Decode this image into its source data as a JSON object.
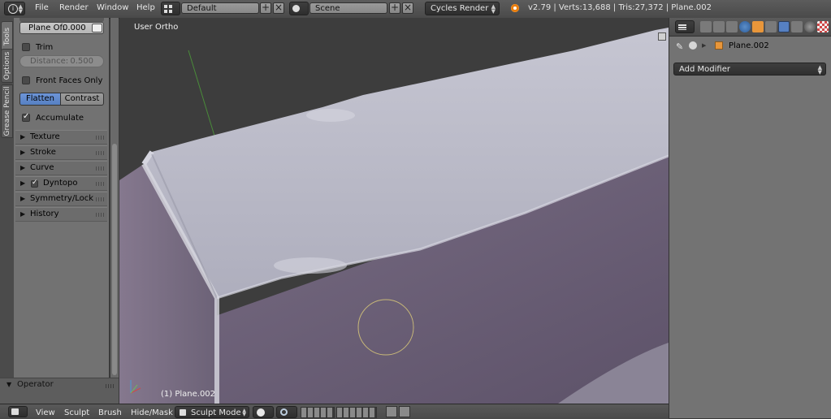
{
  "topbar": {
    "menus": [
      "File",
      "Render",
      "Window",
      "Help"
    ],
    "screen_layout": "Default",
    "scene": "Scene",
    "render_engine": "Cycles Render",
    "stats": "v2.79 | Verts:13,688 | Tris:27,372 | Plane.002"
  },
  "tabs": [
    "Tools",
    "Options",
    "Grease Pencil"
  ],
  "tool_panel": {
    "plane_offset_label": "Plane Of:",
    "plane_offset_value": "0.000",
    "trim_label": "Trim",
    "distance_label": "Distance:",
    "distance_value": "0.500",
    "front_faces_label": "Front Faces Only",
    "mode_flatten": "Flatten",
    "mode_contrast": "Contrast",
    "accumulate_label": "Accumulate",
    "sections": [
      "Texture",
      "Stroke",
      "Curve",
      "Dyntopo",
      "Symmetry/Lock",
      "History"
    ]
  },
  "operator": {
    "label": "Operator"
  },
  "viewport": {
    "view_label": "User Ortho",
    "object_label": "(1) Plane.002"
  },
  "properties": {
    "object_name": "Plane.002",
    "add_modifier": "Add Modifier"
  },
  "bottombar": {
    "menus": [
      "View",
      "Sculpt",
      "Brush",
      "Hide/Mask"
    ],
    "mode": "Sculpt Mode"
  },
  "colors": {
    "accent": "#5680c2",
    "mesh_top": "#b9b9c6",
    "mesh_side": "#6b5f77",
    "brush_circle": "#c8b878"
  }
}
